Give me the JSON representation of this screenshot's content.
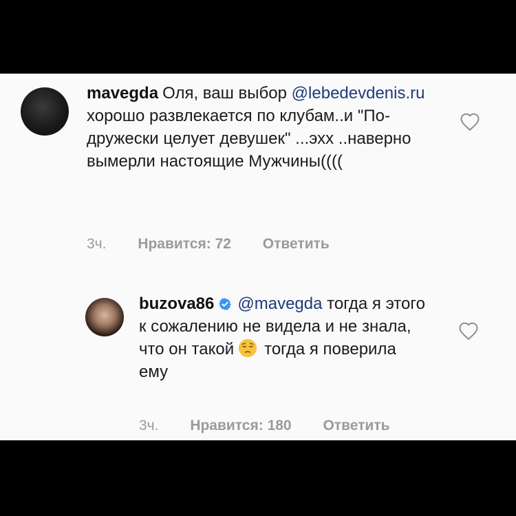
{
  "comments": [
    {
      "username": "mavegda",
      "text_before_mention": "Оля, ваш выбор",
      "mention": "@lebedevdenis.ru",
      "text_after_mention": "хорошо развлекается по клубам..и \"По-дружески целует девушек\" ...эхх ..наверно вымерли настоящие Мужчины((((",
      "time": "3ч.",
      "likes_label": "Нравится: 72",
      "reply_label": "Ответить"
    },
    {
      "username": "buzova86",
      "verified": true,
      "mention": "@mavegda",
      "text_before_emoji": "тогда я этого к сожалению не видела и не знала, что он такой",
      "text_after_emoji": "тогда я поверила ему",
      "time": "3ч.",
      "likes_label": "Нравится: 180",
      "reply_label": "Ответить"
    }
  ],
  "colors": {
    "background_bars": "#000000",
    "panel": "#fafafa",
    "mention": "#1f3a7a",
    "meta": "#9a9a9a",
    "verified": "#3897f0"
  },
  "icons": {
    "like": "heart-icon",
    "verified": "verified-badge-icon",
    "emoji": "pensive-face-emoji"
  }
}
